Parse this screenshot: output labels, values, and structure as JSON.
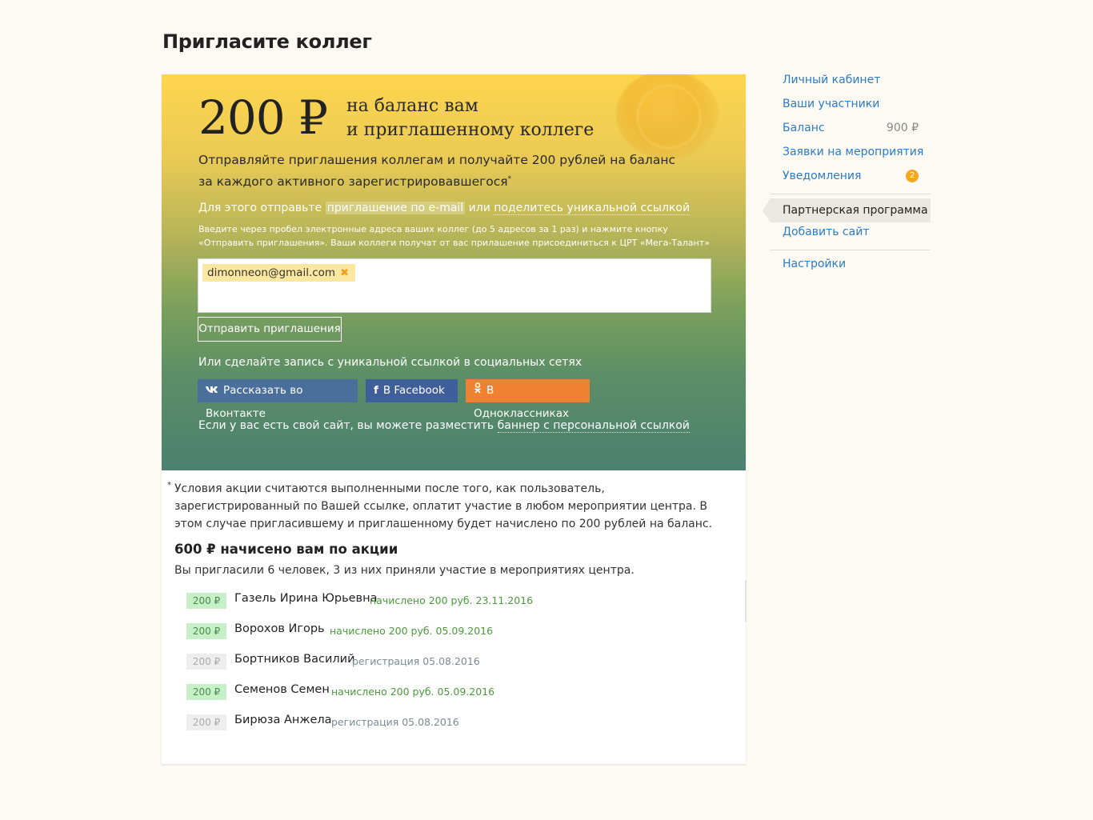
{
  "page": {
    "title": "Пригласите коллег"
  },
  "hero": {
    "amount": "200 ₽",
    "subtitle_line1": "на баланс вам",
    "subtitle_line2": "и приглашенному коллеге",
    "desc_line1": "Отправляйте приглашения коллегам и получайте 200 рублей на баланс",
    "desc_line2": "за каждого активного зарегистрировавшегося",
    "desc_star": "*",
    "hint_prefix": "Для этого отправьте",
    "hint_link_email": "приглашение по e-mail",
    "hint_or": "или",
    "hint_link_share": "поделитесь уникальной ссылкой",
    "note": "Введите через пробел электронные адреса ваших коллег (до 5 адресов за 1 раз) и нажмите кнопку «Отправить приглашения». Ваши коллеги получат от вас прилашение присоединиться к ЦРТ «Мега-Талант»",
    "email_chip": "dimonneon@gmail.com",
    "chip_remove": "✖",
    "send_button": "Отправить приглашения",
    "social_title": "Или сделайте запись с уникальной ссылкой в социальных сетях",
    "vk_icon": "vk",
    "vk_label": "Рассказать во Вконтакте",
    "fb_icon": "f",
    "fb_label": "В Facebook",
    "ok_icon": "ok",
    "ok_label": "В Одноклассниках",
    "banner_prefix": "Если у вас есть свой сайт, вы можете разместить",
    "banner_link": "баннер с персональной ссылкой"
  },
  "terms": {
    "star": "*",
    "text": "Условия акции считаются выполненными после того, как пользователь, зарегистрированный по Вашей ссылке, оплатит участие в любом мероприятии центра. В этом случае пригласившему и приглашенному будет начислено по 200 рублей на баланс."
  },
  "credited": {
    "title": "600 ₽ начисено вам по акции",
    "subtitle": "Вы пригласили 6 человек, 3 из них приняли участие в мероприятиях центра."
  },
  "referrals": [
    {
      "badge": "200 ₽",
      "name": "Газель Ирина Юрьевна",
      "status": "начислено 200 руб. 23.11.2016",
      "paid": true
    },
    {
      "badge": "200 ₽",
      "name": "Ворохов Игорь",
      "status": "начислено 200 руб. 05.09.2016",
      "paid": true
    },
    {
      "badge": "200 ₽",
      "name": "Бортников Василий",
      "status": "регистрация 05.08.2016",
      "paid": false
    },
    {
      "badge": "200 ₽",
      "name": "Семенов Семен",
      "status": "начислено 200 руб. 05.09.2016",
      "paid": true
    },
    {
      "badge": "200 ₽",
      "name": "Бирюза Анжела",
      "status": "регистрация 05.08.2016",
      "paid": false
    }
  ],
  "sidebar": {
    "items": [
      {
        "label": "Личный кабинет"
      },
      {
        "label": "Ваши участники"
      },
      {
        "label": "Баланс",
        "meta": "900 ₽"
      },
      {
        "label": "Заявки на мероприятия"
      },
      {
        "label": "Уведомления",
        "count": "2"
      },
      {
        "label": "Партнерская программа"
      },
      {
        "label": "Добавить сайт"
      },
      {
        "label": "Настройки"
      }
    ]
  },
  "colors": {
    "link": "#2b7bc6",
    "vk": "#4a6f9b",
    "facebook": "#3f5e9a",
    "odnoklassniki": "#ee8230",
    "paid_badge": "#c8f0c8",
    "notification": "#f5a623"
  }
}
